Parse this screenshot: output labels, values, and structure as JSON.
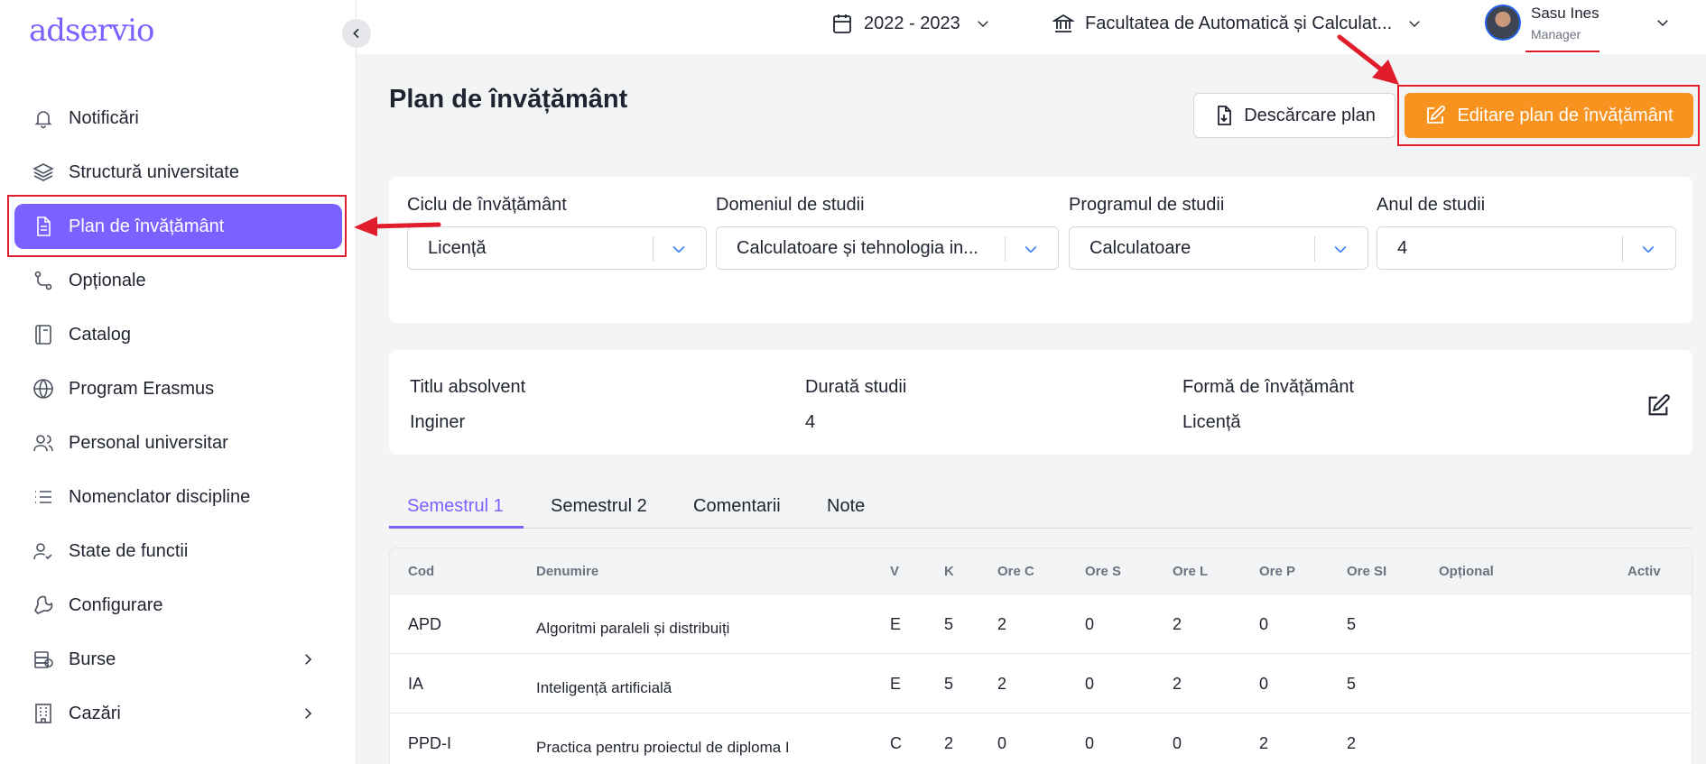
{
  "app": {
    "logo": "adservio"
  },
  "topbar": {
    "year": "2022 - 2023",
    "faculty": "Facultatea de Automatică și Calculat...",
    "user_name": "Sasu Ines",
    "user_role": "Manager"
  },
  "sidebar": {
    "items": [
      {
        "label": "Notificări",
        "icon": "bell-icon"
      },
      {
        "label": "Structură universitate",
        "icon": "layers-icon"
      },
      {
        "label": "Plan de învățământ",
        "icon": "document-icon",
        "active": true
      },
      {
        "label": "Opționale",
        "icon": "branch-icon"
      },
      {
        "label": "Catalog",
        "icon": "book-icon"
      },
      {
        "label": "Program Erasmus",
        "icon": "globe-icon"
      },
      {
        "label": "Personal universitar",
        "icon": "users-icon"
      },
      {
        "label": "Nomenclator discipline",
        "icon": "list-icon"
      },
      {
        "label": "State de functii",
        "icon": "user-check-icon"
      },
      {
        "label": "Configurare",
        "icon": "wrench-icon"
      },
      {
        "label": "Burse",
        "icon": "money-icon",
        "expandable": true
      },
      {
        "label": "Cazări",
        "icon": "building-icon",
        "expandable": true
      }
    ]
  },
  "main": {
    "title": "Plan de învățământ",
    "download_label": "Descărcare plan",
    "edit_label": "Editare plan de învățământ",
    "filters": [
      {
        "label": "Ciclu de învățământ",
        "value": "Licență"
      },
      {
        "label": "Domeniul de studii",
        "value": "Calculatoare și tehnologia in..."
      },
      {
        "label": "Programul de studii",
        "value": "Calculatoare"
      },
      {
        "label": "Anul de studii",
        "value": "4"
      }
    ],
    "info": [
      {
        "label": "Titlu absolvent",
        "value": "Inginer"
      },
      {
        "label": "Durată studii",
        "value": "4"
      },
      {
        "label": "Formă de învățământ",
        "value": "Licență"
      }
    ],
    "tabs": [
      "Semestrul 1",
      "Semestrul 2",
      "Comentarii",
      "Note"
    ],
    "table": {
      "headers": [
        "Cod",
        "Denumire",
        "V",
        "K",
        "Ore C",
        "Ore S",
        "Ore L",
        "Ore P",
        "Ore SI",
        "Opțional",
        "Activ"
      ],
      "rows": [
        [
          "APD",
          "Algoritmi paraleli și distribuiți",
          "E",
          "5",
          "2",
          "0",
          "2",
          "0",
          "5"
        ],
        [
          "IA",
          "Inteligență artificială",
          "E",
          "5",
          "2",
          "0",
          "2",
          "0",
          "5"
        ],
        [
          "PPD-I",
          "Practica pentru proiectul de diploma I",
          "C",
          "2",
          "0",
          "0",
          "0",
          "2",
          "2"
        ]
      ]
    }
  },
  "colors": {
    "accent": "#7b61ff",
    "edit_button": "#f7931e",
    "annotation": "#e11d2b"
  }
}
